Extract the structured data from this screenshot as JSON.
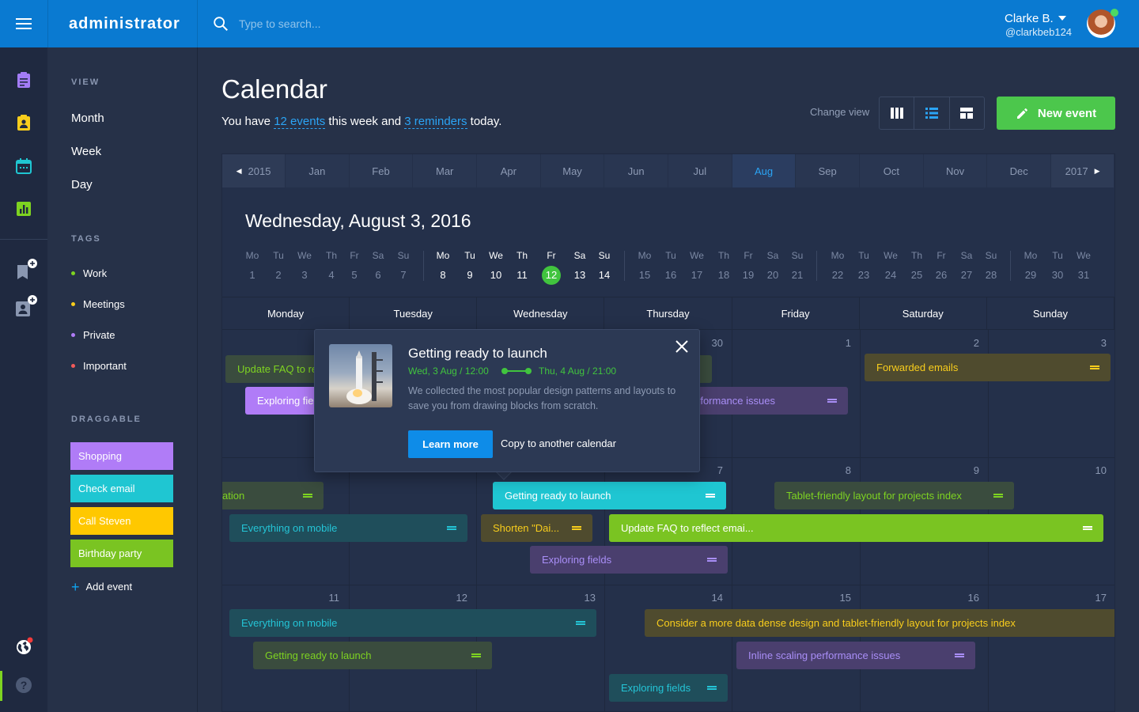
{
  "app": {
    "brand": "administrator"
  },
  "search": {
    "placeholder": "Type to search..."
  },
  "user": {
    "name": "Clarke B.",
    "handle": "@clarkbeb124"
  },
  "sidebar": {
    "view_title": "VIEW",
    "views": [
      "Month",
      "Week",
      "Day"
    ],
    "tags_title": "TAGS",
    "tags": [
      {
        "label": "Work",
        "color": "#7ed321"
      },
      {
        "label": "Meetings",
        "color": "#f8cd1c"
      },
      {
        "label": "Private",
        "color": "#b07cf7"
      },
      {
        "label": "Important",
        "color": "#f25a5a"
      }
    ],
    "draggable_title": "DRAGGABLE",
    "draggables": [
      {
        "label": "Shopping",
        "color": "#b07cf7"
      },
      {
        "label": "Check email",
        "color": "#1fc6d2"
      },
      {
        "label": "Call Steven",
        "color": "#ffc800"
      },
      {
        "label": "Birthday party",
        "color": "#7ac422"
      }
    ],
    "add_event": "Add event"
  },
  "header": {
    "title": "Calendar",
    "sub_pre": "You have ",
    "events_link": "12 events",
    "sub_mid": " this week and ",
    "reminders_link": "3 reminders",
    "sub_post": " today.",
    "change_view": "Change view",
    "new_event": "New event"
  },
  "months": {
    "prev_year": "2015",
    "next_year": "2017",
    "items": [
      "Jan",
      "Feb",
      "Mar",
      "Apr",
      "May",
      "Jun",
      "Jul",
      "Aug",
      "Sep",
      "Oct",
      "Nov",
      "Dec"
    ],
    "active": "Aug"
  },
  "date_title": "Wednesday, August 3,  2016",
  "day_strip": [
    [
      "Mo",
      "1"
    ],
    [
      "Tu",
      "2"
    ],
    [
      "We",
      "3"
    ],
    [
      "Th",
      "4"
    ],
    [
      "Fr",
      "5"
    ],
    [
      "Sa",
      "6"
    ],
    [
      "Su",
      "7"
    ],
    [
      "Mo",
      "8"
    ],
    [
      "Tu",
      "9"
    ],
    [
      "We",
      "10"
    ],
    [
      "Th",
      "11"
    ],
    [
      "Fr",
      "12"
    ],
    [
      "Sa",
      "13"
    ],
    [
      "Su",
      "14"
    ],
    [
      "Mo",
      "15"
    ],
    [
      "Tu",
      "16"
    ],
    [
      "We",
      "17"
    ],
    [
      "Th",
      "18"
    ],
    [
      "Fr",
      "19"
    ],
    [
      "Sa",
      "20"
    ],
    [
      "Su",
      "21"
    ],
    [
      "Mo",
      "22"
    ],
    [
      "Tu",
      "23"
    ],
    [
      "We",
      "24"
    ],
    [
      "Th",
      "25"
    ],
    [
      "Fr",
      "26"
    ],
    [
      "Sa",
      "27"
    ],
    [
      "Su",
      "28"
    ],
    [
      "Mo",
      "29"
    ],
    [
      "Tu",
      "30"
    ],
    [
      "We",
      "31"
    ]
  ],
  "today": "12",
  "week_days": [
    "Monday",
    "Tuesday",
    "Wednesday",
    "Thursday",
    "Friday",
    "Saturday",
    "Sunday"
  ],
  "day_numbers": {
    "row1": [
      "30",
      "1",
      "2",
      "3"
    ],
    "row2": [
      "7",
      "8",
      "9",
      "10"
    ],
    "row3": [
      "11",
      "12",
      "13",
      "14",
      "15",
      "16",
      "17"
    ]
  },
  "events": [
    {
      "label": "Update FAQ to re"
    },
    {
      "label": "Exploring fie"
    },
    {
      "label": "rformance issues"
    },
    {
      "label": "Forwarded emails"
    },
    {
      "label": "ation"
    },
    {
      "label": "Getting ready to launch"
    },
    {
      "label": "Tablet-friendly layout for projects index"
    },
    {
      "label": "Everything on mobile"
    },
    {
      "label": "Shorten \"Dai..."
    },
    {
      "label": "Update FAQ to reflect emai..."
    },
    {
      "label": "Exploring fields"
    },
    {
      "label": "Everything on mobile"
    },
    {
      "label": "Consider a more data dense design and tablet-friendly layout for projects index"
    },
    {
      "label": "Getting ready to launch"
    },
    {
      "label": "Inline scaling performance issues"
    },
    {
      "label": "Exploring fields"
    }
  ],
  "popover": {
    "title": "Getting ready to launch",
    "start": "Wed, 3 Aug / 12:00",
    "end": "Thu, 4 Aug / 21:00",
    "description": "We collected the most popular design patterns and layouts to save you from drawing blocks from scratch.",
    "learn_more": "Learn more",
    "copy": "Copy to another calendar"
  }
}
